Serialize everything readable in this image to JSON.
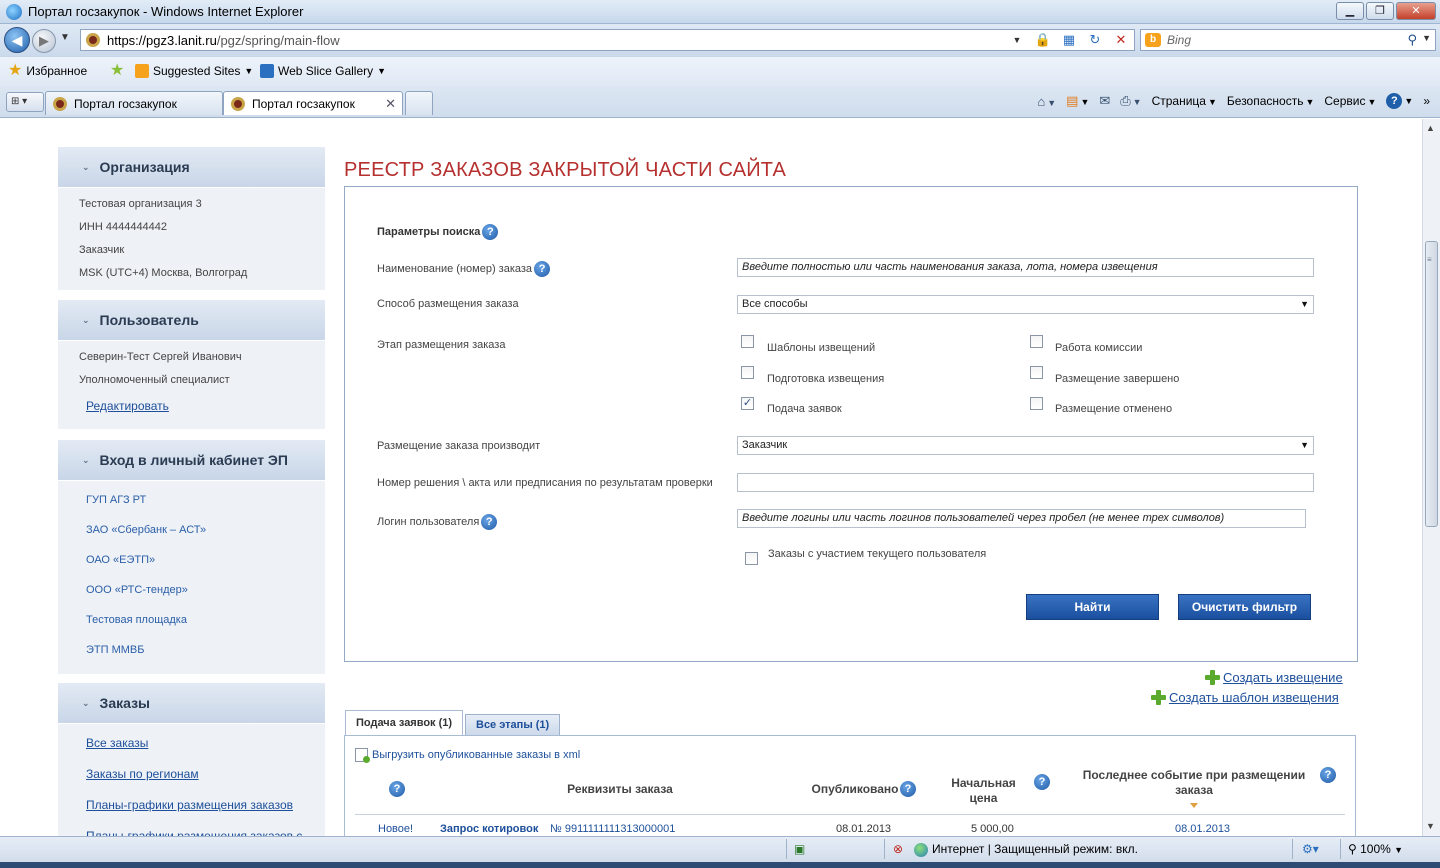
{
  "browser": {
    "window_title": "Портал госзакупок - Windows Internet Explorer",
    "url_host": "https://pgz3.lanit.ru",
    "url_path": "/pgz/spring/main-flow",
    "search_placeholder": "Bing",
    "favorites": {
      "favorites_label": "Избранное",
      "suggested_sites": "Suggested Sites",
      "web_slice_gallery": "Web Slice Gallery"
    },
    "tabs": [
      {
        "label": "Портал госзакупок"
      },
      {
        "label": "Портал госзакупок"
      }
    ],
    "commands": {
      "page": "Страница",
      "safety": "Безопасность",
      "service": "Сервис"
    },
    "status": {
      "zone": "Интернет | Защищенный режим: вкл.",
      "zoom": "100%"
    }
  },
  "sidebar": {
    "organization": {
      "title": "Организация",
      "lines": [
        "Тестовая организация 3",
        "ИНН 4444444442",
        "Заказчик",
        "MSK (UTC+4) Москва, Волгоград"
      ]
    },
    "user": {
      "title": "Пользователь",
      "lines": [
        "Северин-Тест Сергей Иванович",
        "Уполномоченный специалист"
      ],
      "edit_link": "Редактировать"
    },
    "ep_cabinet": {
      "title": "Вход в личный кабинет ЭП",
      "links": [
        "ГУП АГЗ РТ",
        "ЗАО «Сбербанк – АСТ»",
        "ОАО «ЕЭТП»",
        "ООО «РТС-тендер»",
        "Тестовая площадка",
        "ЭТП ММВБ"
      ]
    },
    "orders": {
      "title": "Заказы",
      "links": [
        "Все заказы",
        "Заказы по регионам",
        "Планы-графики размещения заказов",
        "Планы-графики размещения заказов с"
      ]
    }
  },
  "main": {
    "title": "РЕЕСТР ЗАКАЗОВ ЗАКРЫТОЙ ЧАСТИ САЙТА",
    "filter": {
      "params_label": "Параметры поиска",
      "name_label": "Наименование (номер) заказа",
      "name_placeholder": "Введите полностью или часть наименования заказа, лота, номера извещения",
      "method_label": "Способ размещения заказа",
      "method_value": "Все способы",
      "stage_label": "Этап размещения заказа",
      "stages": [
        {
          "label": "Шаблоны извещений",
          "checked": false
        },
        {
          "label": "Подготовка извещения",
          "checked": false
        },
        {
          "label": "Подача заявок",
          "checked": true
        },
        {
          "label": "Работа комиссии",
          "checked": false
        },
        {
          "label": "Размещение завершено",
          "checked": false
        },
        {
          "label": "Размещение отменено",
          "checked": false
        }
      ],
      "placer_label": "Размещение заказа производит",
      "placer_value": "Заказчик",
      "decision_label": "Номер решения \\ акта или предписания по результатам проверки",
      "decision_value": "",
      "login_label": "Логин пользователя",
      "login_placeholder": "Введите логины или часть логинов пользователей через пробел (не менее трех символов)",
      "participation_label": "Заказы с участием текущего пользователя",
      "find_button": "Найти",
      "clear_button": "Очистить фильтр"
    },
    "create_notice": "Создать извещение",
    "create_template": "Создать шаблон извещения",
    "result_tabs": [
      {
        "label": "Подача заявок (1)"
      },
      {
        "label": "Все этапы (1)"
      }
    ],
    "export_xml": "Выгрузить опубликованные заказы в xml",
    "table": {
      "headers": [
        "Реквизиты заказа",
        "Опубликовано",
        "Начальная цена",
        "Последнее событие при размещении заказа"
      ],
      "rows": [
        {
          "status": "Новое!",
          "type": "Запрос котировок",
          "number": "№  9911111111313000001",
          "published": "08.01.2013",
          "price": "5 000,00",
          "last_event": "08.01.2013"
        }
      ]
    }
  }
}
